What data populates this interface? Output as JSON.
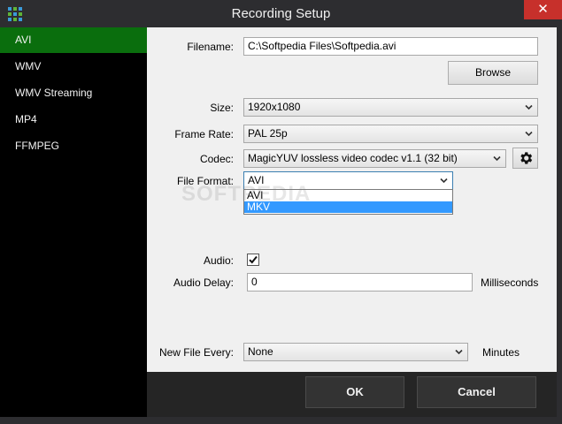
{
  "window": {
    "title": "Recording Setup",
    "close_glyph": "✕",
    "accent": "#0a6e0d"
  },
  "sidebar": {
    "items": [
      {
        "label": "AVI",
        "selected": true
      },
      {
        "label": "WMV",
        "selected": false
      },
      {
        "label": "WMV Streaming",
        "selected": false
      },
      {
        "label": "MP4",
        "selected": false
      },
      {
        "label": "FFMPEG",
        "selected": false
      }
    ]
  },
  "form": {
    "filename_label": "Filename:",
    "filename_value": "C:\\Softpedia Files\\Softpedia.avi",
    "browse_label": "Browse",
    "size_label": "Size:",
    "size_value": "1920x1080",
    "framerate_label": "Frame Rate:",
    "framerate_value": "PAL 25p",
    "codec_label": "Codec:",
    "codec_value": "MagicYUV lossless video codec v1.1 (32 bit)",
    "codec_settings_icon": "gear-icon",
    "fileformat_label": "File Format:",
    "fileformat_value": "AVI",
    "fileformat_options": [
      "AVI",
      "MKV"
    ],
    "fileformat_highlighted": "MKV",
    "audio_label": "Audio:",
    "audio_checked": true,
    "audio_delay_label": "Audio Delay:",
    "audio_delay_value": "0",
    "audio_delay_unit": "Milliseconds",
    "new_file_label": "New File Every:",
    "new_file_value": "None",
    "new_file_unit": "Minutes"
  },
  "footer": {
    "ok_label": "OK",
    "cancel_label": "Cancel"
  },
  "watermark": "SOFTPEDIA"
}
